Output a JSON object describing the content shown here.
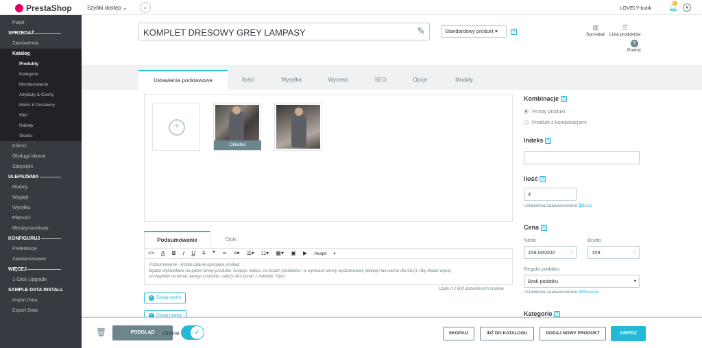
{
  "topbar": {
    "logo": "PrestaShop",
    "quick_access": "Szybki dostęp",
    "shop_name": "LOVELY-butik",
    "notif_count": "1"
  },
  "sidebar": {
    "dashboard": "Pulpit",
    "sections": [
      {
        "heading": "SPRZEDAŻ",
        "items": [
          "Zamówienia"
        ]
      },
      {
        "catalog": "Katalog",
        "sub": [
          "Produkty",
          "Kategorie",
          "Monitorowanie",
          "Atrybuty & Cechy",
          "Marki & Dostawcy",
          "Pliki",
          "Rabaty",
          "Stocks"
        ]
      },
      {
        "items2": [
          "Klienci",
          "Obsługa klienta",
          "Statystyki"
        ]
      },
      {
        "heading": "ULEPSZENIA",
        "items": [
          "Moduły",
          "Wygląd",
          "Wysyłka",
          "Płatność",
          "Międzynarodowy"
        ]
      },
      {
        "heading": "KONFIGURUJ",
        "items": [
          "Preferencje",
          "Zaawansowane"
        ]
      },
      {
        "heading": "WIĘCEJ",
        "items": [
          "1-Click Upgrade"
        ]
      },
      {
        "heading": "SAMPLE DATA INSTALL",
        "items": [
          "Import Data",
          "Export Data"
        ]
      }
    ]
  },
  "header": {
    "product_name": "KOMPLET DRESOWY GREY LAMPASY",
    "product_type": "Standardowy produkt",
    "toolbar": [
      {
        "label": "Sprzedaż",
        "icon": "chart-icon"
      },
      {
        "label": "Lista produktów",
        "icon": "list-icon"
      },
      {
        "label": "Pomoc",
        "icon": "help-icon"
      }
    ]
  },
  "tabs": [
    "Ustawienia podstawowe",
    "Ilości",
    "Wysyłka",
    "Wycena",
    "SEO",
    "Opcje",
    "Moduły"
  ],
  "images": {
    "cover_label": "Okładka"
  },
  "description": {
    "tabs": [
      "Podsumowanie",
      "Opis"
    ],
    "paragraph_label": "Akapit",
    "placeholder_lines": [
      "Podsumowanie - krótkie zdanie opisujące produkt.",
      "Będzie wyświetlane na górze strony produktu Twojego sklepu, na listach produktów i w wynikach strony wyszukiwarek (dlatego tak ważne dla SEO). Aby dodać więcej",
      "szczegółów na temat danego produktu, należy skorzystać z zakładki \"Opis\"."
    ],
    "counter": "Użyto 0 z 800 dozwolonych znaków",
    "add_feature": "Dodaj cechę",
    "add_brand": "Dodaj markę"
  },
  "right": {
    "combinations_label": "Kombinacje",
    "radio_simple": "Prosty produkt",
    "radio_combo": "Produkt z kombinacjami",
    "index_label": "Indeks",
    "index_value": "",
    "quantity_label": "Ilość",
    "quantity_value": "4",
    "advanced_settings": "Ustawienia zaawansowane",
    "quantity_link": "Ilości",
    "price_label": "Cena",
    "net_label": "Netto",
    "gross_label": "Brutto",
    "net_value": "159,000000",
    "gross_value": "159",
    "currency": "zł",
    "tax_rule_label": "Reguła podatku",
    "tax_rule_value": "Brak podatku",
    "pricing_link": "Wycena",
    "category_label": "Kategorie"
  },
  "footer": {
    "preview": "PODGLĄD",
    "online": "Online",
    "duplicate": "SKOPIUJ",
    "go_catalog": "IDŹ DO KATALOGU",
    "add_new": "DODAJ NOWY PRODUKT",
    "save": "ZAPISZ"
  },
  "colors": {
    "accent": "#25b9d7",
    "sidebar": "#363a41",
    "brand": "#df0067"
  }
}
